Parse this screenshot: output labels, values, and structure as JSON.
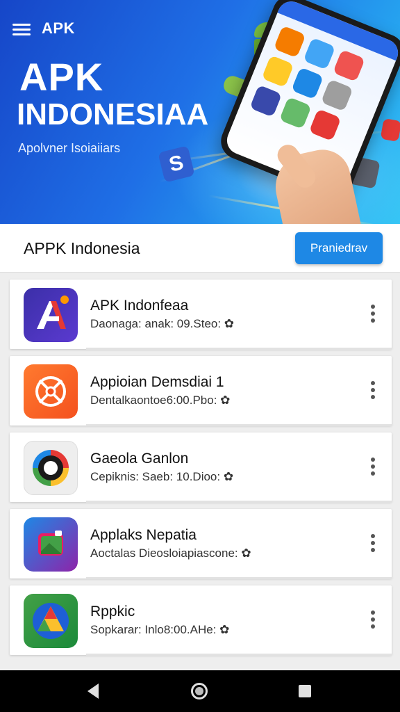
{
  "hero": {
    "brand": "APK",
    "title_line1": "APK",
    "title_line2": "INDONESIAA",
    "subtitle": "Apolvner Isoiaiiars"
  },
  "header": {
    "title": "APPK Indonesia",
    "button_label": "Praniedrav"
  },
  "apps": [
    {
      "name": "APK Indonfeaa",
      "meta": "Daonaga: anak: 09.Steo: ✿",
      "icon": "letter-a-icon"
    },
    {
      "name": "Appioian Demsdiai 1",
      "meta": "Dentalkaontoe6:00.Pbo: ✿",
      "icon": "lens-crosshair-icon"
    },
    {
      "name": "Gaeola Ganlon",
      "meta": "Cepiknis: Saeb: 10.Dioo: ✿",
      "icon": "target-ring-icon"
    },
    {
      "name": "Applaks Nepatia",
      "meta": "Aoctalas Dieosloiapiascone: ✿",
      "icon": "gallery-icon"
    },
    {
      "name": "Rppkic",
      "meta": "Sopkarar: Inlo8:00.AHe: ✿",
      "icon": "triangle-logo-icon"
    }
  ],
  "colors": {
    "hero_start": "#1646c8",
    "hero_end": "#37c6f5",
    "accent": "#1e88e5",
    "navbar": "#000000"
  },
  "navbar": {
    "back_icon": "back-icon",
    "home_icon": "home-icon",
    "recents_icon": "recents-icon"
  }
}
